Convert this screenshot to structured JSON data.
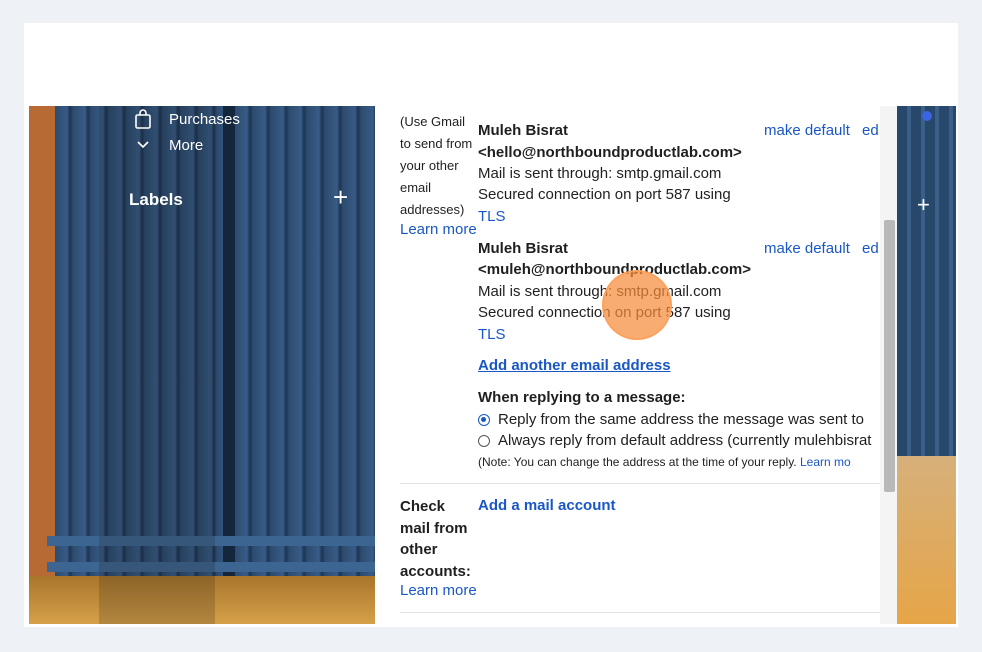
{
  "sidebar": {
    "items": [
      {
        "label": "Purchases",
        "icon": "shopping-bag-icon"
      },
      {
        "label": "More",
        "icon": "chevron-down-icon"
      }
    ],
    "labels_title": "Labels",
    "labels_add": "+"
  },
  "right_rail": {
    "add": "+"
  },
  "send_mail_as": {
    "hint_lines": [
      "(Use Gmail",
      "to send from",
      "your other",
      "email",
      "addresses)"
    ],
    "learn_more": "Learn more",
    "accounts": [
      {
        "name": "Muleh Bisrat",
        "address": "<hello@northboundproductlab.com>",
        "via": "Mail is sent through: smtp.gmail.com",
        "secured": "Secured connection on port 587 using",
        "protocol": "TLS",
        "make_default": "make default",
        "edit": "ed"
      },
      {
        "name": "Muleh Bisrat",
        "address": "<muleh@northboundproductlab.com>",
        "via": "Mail is sent through: smtp.gmail.com",
        "secured": "Secured connection on port 587 using",
        "protocol": "TLS",
        "make_default": "make default",
        "edit": "ed"
      }
    ],
    "add_another": "Add another email address",
    "replying_title": "When replying to a message:",
    "reply_options": [
      {
        "label": "Reply from the same address the message was sent to",
        "selected": true
      },
      {
        "label": "Always reply from default address (currently mulehbisrat",
        "selected": false
      }
    ],
    "note": "(Note: You can change the address at the time of your reply.",
    "note_link": "Learn mo"
  },
  "check_mail": {
    "title_lines": [
      "Check",
      "mail from",
      "other",
      "accounts:"
    ],
    "learn_more": "Learn more",
    "add_account": "Add a mail account"
  },
  "colors": {
    "link": "#1a57c6",
    "cursor_highlight": "#f58c3c"
  }
}
